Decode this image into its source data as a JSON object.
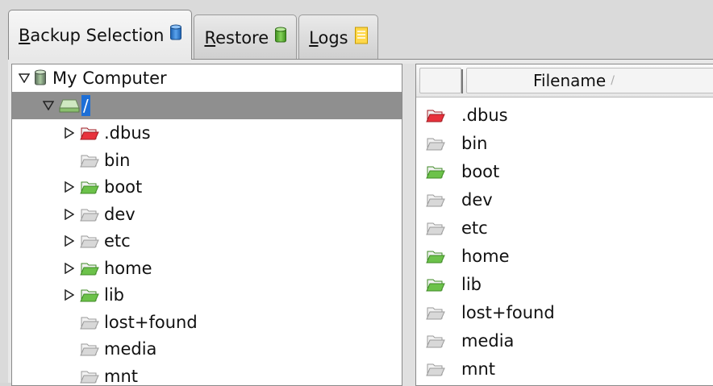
{
  "tabs": [
    {
      "label_underlined": "B",
      "label_rest": "ackup Selection",
      "icon": "database-blue-icon",
      "active": true
    },
    {
      "label_underlined": "R",
      "label_rest": "estore",
      "icon": "database-green-icon",
      "active": false
    },
    {
      "label_underlined": "L",
      "label_rest": "ogs",
      "icon": "log-document-icon",
      "active": false
    }
  ],
  "tree": {
    "computer": "My Computer",
    "root": "/",
    "items": [
      {
        "name": ".dbus",
        "color": "red",
        "expandable": true
      },
      {
        "name": "bin",
        "color": "grey",
        "expandable": false
      },
      {
        "name": "boot",
        "color": "green",
        "expandable": true
      },
      {
        "name": "dev",
        "color": "grey",
        "expandable": true
      },
      {
        "name": "etc",
        "color": "grey",
        "expandable": true
      },
      {
        "name": "home",
        "color": "green",
        "expandable": true
      },
      {
        "name": "lib",
        "color": "green",
        "expandable": true
      },
      {
        "name": "lost+found",
        "color": "grey",
        "expandable": false
      },
      {
        "name": "media",
        "color": "grey",
        "expandable": false
      },
      {
        "name": "mnt",
        "color": "grey",
        "expandable": false
      }
    ]
  },
  "list": {
    "header_filename": "Filename",
    "sort_indicator": "/",
    "rows": [
      {
        "name": ".dbus",
        "color": "red"
      },
      {
        "name": "bin",
        "color": "grey"
      },
      {
        "name": "boot",
        "color": "green"
      },
      {
        "name": "dev",
        "color": "grey"
      },
      {
        "name": "etc",
        "color": "grey"
      },
      {
        "name": "home",
        "color": "green"
      },
      {
        "name": "lib",
        "color": "green"
      },
      {
        "name": "lost+found",
        "color": "grey"
      },
      {
        "name": "media",
        "color": "grey"
      },
      {
        "name": "mnt",
        "color": "grey"
      }
    ]
  },
  "colors": {
    "folder_red": "#e8323c",
    "folder_green": "#6cc24a",
    "folder_grey": "#d8d8d8",
    "selection": "#1e6fd6",
    "tree_selected_row": "#8f8f8f"
  }
}
